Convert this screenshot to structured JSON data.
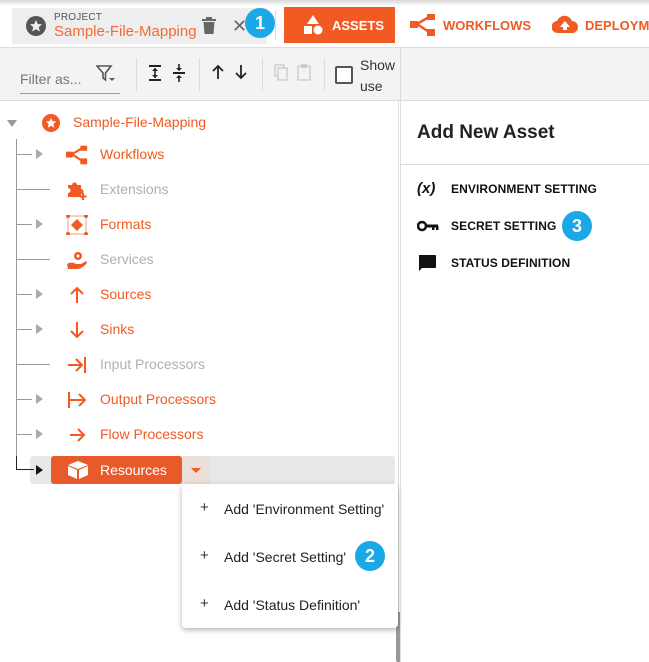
{
  "project": {
    "caption": "PROJECT",
    "name": "Sample-File-Mapping"
  },
  "tabs": [
    {
      "label": "ASSETS",
      "icon": "shapes-icon",
      "active": true
    },
    {
      "label": "WORKFLOWS",
      "icon": "workflow-icon",
      "active": false
    },
    {
      "label": "DEPLOYME",
      "icon": "cloud-upload-icon",
      "active": false
    }
  ],
  "toolbar": {
    "filter_placeholder": "Filter as...",
    "show_use_label": "Show use",
    "show_use_checked": false
  },
  "tree": {
    "root": "Sample-File-Mapping",
    "items": [
      {
        "label": "Workflows",
        "icon": "workflow-icon",
        "expandable": true,
        "disabled": false
      },
      {
        "label": "Extensions",
        "icon": "extension-icon",
        "expandable": false,
        "disabled": true
      },
      {
        "label": "Formats",
        "icon": "format-icon",
        "expandable": true,
        "disabled": false
      },
      {
        "label": "Services",
        "icon": "service-icon",
        "expandable": false,
        "disabled": true
      },
      {
        "label": "Sources",
        "icon": "arrow-up-icon",
        "expandable": true,
        "disabled": false
      },
      {
        "label": "Sinks",
        "icon": "arrow-down-icon",
        "expandable": true,
        "disabled": false
      },
      {
        "label": "Input Processors",
        "icon": "input-processor-icon",
        "expandable": false,
        "disabled": true
      },
      {
        "label": "Output Processors",
        "icon": "output-processor-icon",
        "expandable": true,
        "disabled": false
      },
      {
        "label": "Flow Processors",
        "icon": "arrow-right-icon",
        "expandable": true,
        "disabled": false
      }
    ],
    "selected": "Resources"
  },
  "context_menu": {
    "items": [
      {
        "label": "Add 'Environment Setting'"
      },
      {
        "label": "Add 'Secret Setting'"
      },
      {
        "label": "Add 'Status Definition'"
      }
    ]
  },
  "right_panel": {
    "title": "Add New Asset",
    "items": [
      {
        "label": "ENVIRONMENT SETTING",
        "icon": "variable-icon",
        "glyph": "(x)"
      },
      {
        "label": "SECRET SETTING",
        "icon": "key-icon"
      },
      {
        "label": "STATUS DEFINITION",
        "icon": "comment-icon"
      }
    ]
  },
  "badges": [
    "1",
    "2",
    "3"
  ],
  "colors": {
    "accent": "#f15a22",
    "badge": "#1aa8e6"
  }
}
